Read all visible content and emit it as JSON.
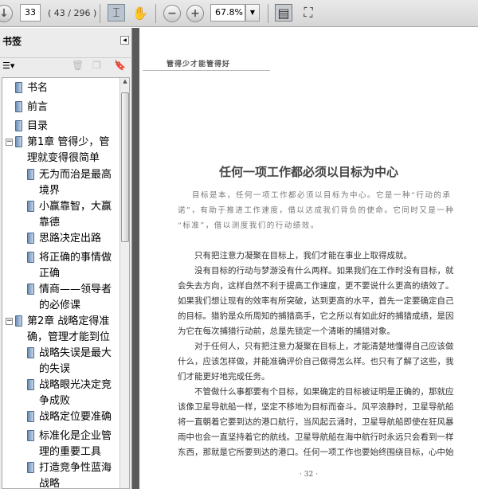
{
  "toolbar": {
    "page_value": "33",
    "page_count": "( 43 / 296 )",
    "zoom_value": "67.8%"
  },
  "sidebar": {
    "title": "书签",
    "items": [
      {
        "label": "书名"
      },
      {
        "label": "前言"
      },
      {
        "label": "目录"
      },
      {
        "label": "第1章 管得少，管理就变得很简单",
        "lines": [
          "第1章 管得少，管",
          "理就变得很简单"
        ]
      },
      {
        "lines": [
          "无为而治是最高",
          "境界"
        ]
      },
      {
        "lines": [
          "小赢靠智，大赢",
          "靠德"
        ]
      },
      {
        "lines": [
          "思路决定出路"
        ]
      },
      {
        "lines": [
          "将正确的事情做",
          "正确"
        ]
      },
      {
        "lines": [
          "情商——领导者",
          "的必修课"
        ]
      },
      {
        "lines": [
          "第2章 战略定得准",
          "确，管理才能到位"
        ]
      },
      {
        "lines": [
          "战略失误是最大",
          "的失误"
        ]
      },
      {
        "lines": [
          "战略眼光决定竞",
          "争成败"
        ]
      },
      {
        "lines": [
          "战略定位要准确"
        ]
      },
      {
        "lines": [
          "标准化是企业管",
          "理的重要工具"
        ]
      },
      {
        "lines": [
          "打造竞争性蓝海",
          "战略"
        ]
      }
    ]
  },
  "page": {
    "running_head": "管得少才能管得好",
    "title": "任何一项工作都必须以目标为中心",
    "intro": [
      "目标是本，任何一项工作都必须以目标为中心。它是一种“行动的承",
      "诺”，有助于推进工作速度，借以达成我们背负的使命。它同时又是一种",
      "“标准”，借以测度我们的行动绩效。"
    ],
    "body": [
      "　　只有把注意力凝聚在目标上，我们才能在事业上取得成就。",
      "　　没有目标的行动与梦游没有什么两样。如果我们在工作时没有目标，就",
      "会失去方向，这样自然不利于提高工作速度，更不要说什么更高的绩效了。",
      "如果我们想让现有的效率有所突破，达到更高的水平，首先一定要确定自己",
      "的目标。猎豹是众所周知的捕猎高手，它之所以有如此好的捕猎成绩，是因",
      "为它在每次捕猎行动前，总是先锁定一个清晰的捕猎对象。",
      "　　对于任何人，只有把注意力凝聚在目标上，才能清楚地懂得自己应该做",
      "什么，应该怎样做，并能准确评价自己做得怎么样。也只有了解了这些，我",
      "们才能更好地完成任务。",
      "　　不管做什么事都要有个目标，如果确定的目标被证明是正确的，那就应",
      "该像卫星导航船一样，坚定不移地为目标而奋斗。风平浪静时，卫星导航船",
      "将一直朝着它要到达的港口航行，当风起云涌时，卫星导航船即使在狂风暴",
      "雨中也会一直坚持着它的航线。卫星导航船在海中航行时永远只会看到一样",
      "东西，那就是它所要到达的港口。任何一项工作也要始终围绕目标，心中始"
    ],
    "page_number": "· 32 ·"
  }
}
